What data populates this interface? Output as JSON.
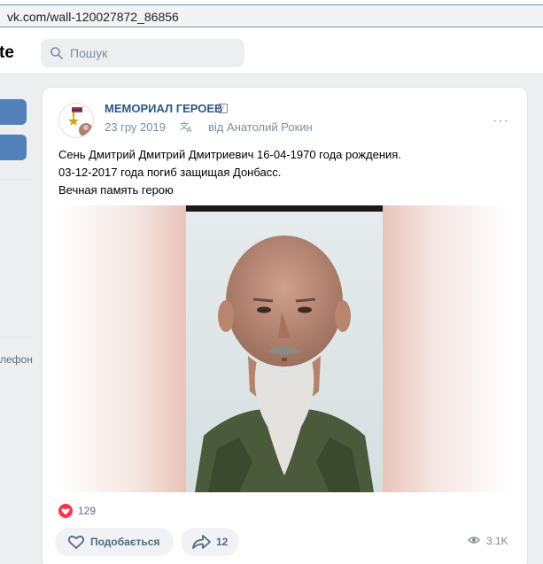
{
  "browser": {
    "url": "vk.com/wall-120027872_86856"
  },
  "header": {
    "logo_fragment": "te",
    "search_placeholder": "Пошук"
  },
  "sidebar": {
    "fragment_text": "лефон"
  },
  "post": {
    "group_name": "МЕМОРИАЛ ГЕРОЕВ",
    "verify_glyph": "✓",
    "date": "23 гру 2019",
    "via": "від Анатолий Рокин",
    "more": "···",
    "text_lines": [
      "Сень Дмитрий Дмитрий Дмитриевич 16-04-1970 года рождения.",
      "03-12-2017 года погиб защищая Донбасс.",
      "Вечная память герою"
    ],
    "likes_count": "129",
    "like_button_label": "Подобається",
    "share_count": "12",
    "views": "3.1K"
  },
  "colors": {
    "link": "#2a5885",
    "accent": "#5181b8",
    "like": "#ff3347"
  },
  "icons": [
    "search-icon",
    "translate-icon",
    "heart-icon",
    "share-icon",
    "eye-icon",
    "more-icon"
  ]
}
